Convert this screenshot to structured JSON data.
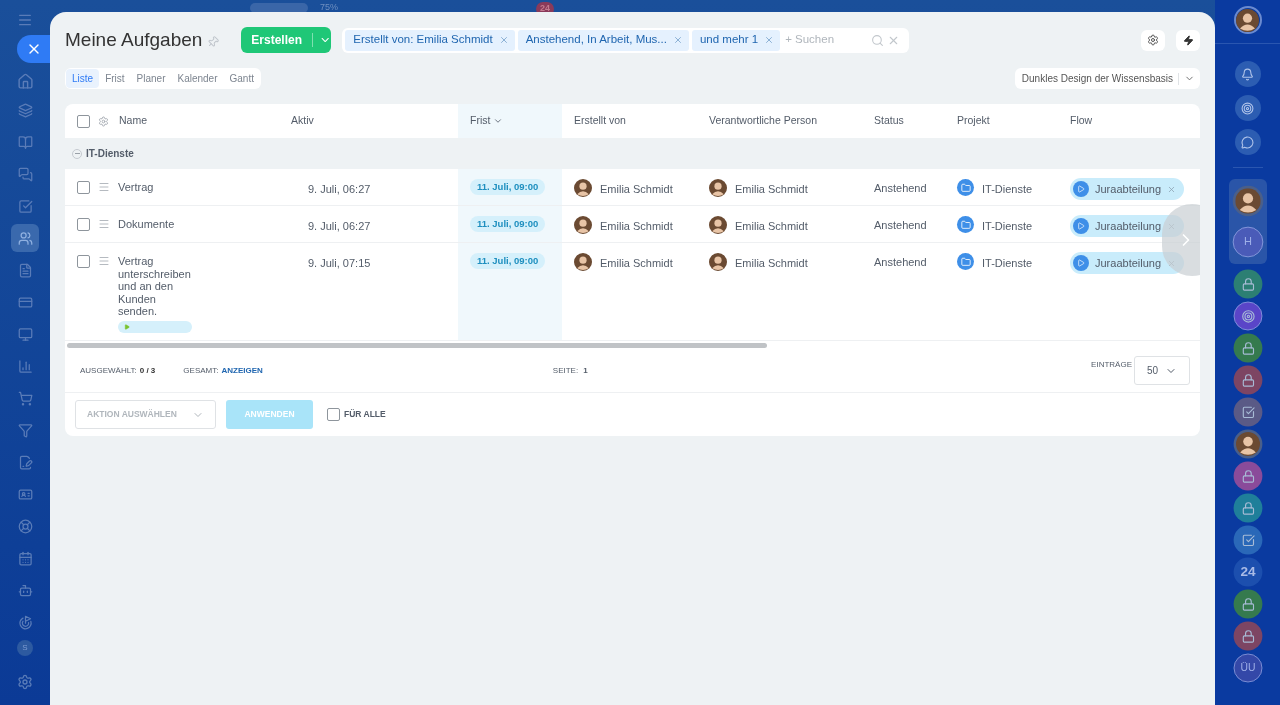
{
  "top_bar": {
    "zoom": "75%",
    "badge": "24"
  },
  "left_nav": {
    "items": [
      {
        "selected": false
      },
      {
        "selected": false
      },
      {
        "selected": false
      },
      {
        "selected": false
      },
      {
        "selected": true
      },
      {
        "selected": false
      },
      {
        "selected": false
      },
      {
        "selected": false
      },
      {
        "selected": false
      },
      {
        "selected": false
      },
      {
        "selected": false
      },
      {
        "selected": false
      },
      {
        "selected": false
      },
      {
        "selected": false
      },
      {
        "selected": false
      },
      {
        "selected": false
      },
      {
        "selected": false
      }
    ],
    "user_initial": "S"
  },
  "header": {
    "title": "Meine Aufgaben",
    "create_button": "Erstellen",
    "filters": [
      "Erstellt von: Emilia Schmidt",
      "Anstehend, In Arbeit, Mus...",
      "und mehr 1"
    ],
    "search_placeholder": "+ Suchen"
  },
  "view_tabs": [
    {
      "label": "Liste",
      "selected": true
    },
    {
      "label": "Frist",
      "selected": false
    },
    {
      "label": "Planer",
      "selected": false
    },
    {
      "label": "Kalender",
      "selected": false
    },
    {
      "label": "Gantt",
      "selected": false
    }
  ],
  "theme_select": "Dunkles Design der Wissensbasis",
  "table": {
    "columns": [
      {
        "label": "Name",
        "sorted": false
      },
      {
        "label": "Aktiv",
        "sorted": false
      },
      {
        "label": "Frist",
        "sorted": true
      },
      {
        "label": "Erstellt von",
        "sorted": false
      },
      {
        "label": "Verantwortliche Person",
        "sorted": false
      },
      {
        "label": "Status",
        "sorted": false
      },
      {
        "label": "Projekt",
        "sorted": false
      },
      {
        "label": "Flow",
        "sorted": false
      }
    ],
    "all_checked": false,
    "groups": [
      {
        "name": "IT-Dienste",
        "expanded": true,
        "rows": [
          {
            "checked": false,
            "name": "Vertrag",
            "active": "9. Juli, 06:27",
            "deadline": "11. Juli, 09:00",
            "created_by": "Emilia Schmidt",
            "responsible": "Emilia Schmidt",
            "status": "Anstehend",
            "project": "IT-Dienste",
            "flow": "Juraabteilung",
            "timer": false
          },
          {
            "checked": false,
            "name": "Dokumente",
            "active": "9. Juli, 06:27",
            "deadline": "11. Juli, 09:00",
            "created_by": "Emilia Schmidt",
            "responsible": "Emilia Schmidt",
            "status": "Anstehend",
            "project": "IT-Dienste",
            "flow": "Juraabteilung",
            "timer": false
          },
          {
            "checked": false,
            "name": "Vertrag unterschreiben und an den Kunden senden.",
            "active": "9. Juli, 07:15",
            "deadline": "11. Juli, 09:00",
            "created_by": "Emilia Schmidt",
            "responsible": "Emilia Schmidt",
            "status": "Anstehend",
            "project": "IT-Dienste",
            "flow": "Juraabteilung",
            "timer": true
          }
        ]
      }
    ]
  },
  "footer": {
    "selected_label": "AUSGEWÄHLT:",
    "selected_value": "0 / 3",
    "total_label": "GESAMT:",
    "total_link": "ANZEIGEN",
    "page_label": "SEITE:",
    "page": "1",
    "entries_label": "EINTRÄGE",
    "entries": "50"
  },
  "actions": {
    "action_select": "AKTION AUSWÄHLEN",
    "apply": {
      "label": "ANWENDEN",
      "disabled": true
    },
    "for_all": {
      "label": "FÜR ALLE",
      "checked": false
    }
  },
  "right_sidebar": {
    "pinned": [
      {
        "kind": "avatar"
      },
      {
        "kind": "initials",
        "label": "H",
        "color": "#4a5bb8"
      }
    ],
    "items": [
      {
        "kind": "lock",
        "color": "#2c7f73"
      },
      {
        "kind": "logo",
        "color": "#5a45c8"
      },
      {
        "kind": "lock",
        "color": "#357a4e"
      },
      {
        "kind": "lock",
        "color": "#7d4563"
      },
      {
        "kind": "task",
        "color": "#5a5a86"
      },
      {
        "kind": "avatar"
      },
      {
        "kind": "lock",
        "color": "#8a4b9a"
      },
      {
        "kind": "lock",
        "color": "#1f7f9a"
      },
      {
        "kind": "task",
        "color": "#2a68b8"
      },
      {
        "kind": "text",
        "label": "24",
        "color": "#1c4fae"
      },
      {
        "kind": "lock",
        "color": "#357a4e"
      },
      {
        "kind": "lock",
        "color": "#7d4563"
      },
      {
        "kind": "initials",
        "label": "ÜU",
        "color": "#3448a8"
      }
    ]
  }
}
